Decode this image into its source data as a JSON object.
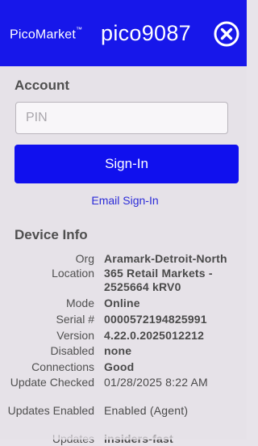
{
  "header": {
    "brand": "PicoMarket",
    "trademark": "™",
    "device_id": "pico9087",
    "close_icon": "close-circle-icon",
    "background_color": "#1717ea"
  },
  "account": {
    "title": "Account",
    "pin_placeholder": "PIN",
    "pin_value": "",
    "signin_label": "Sign-In",
    "email_signin_label": "Email Sign-In"
  },
  "device_info": {
    "title": "Device Info",
    "rows": [
      {
        "label": "Org",
        "value": "Aramark-Detroit-North"
      },
      {
        "label": "Location",
        "value": "365 Retail Markets - 2525664 kRV0"
      },
      {
        "label": "Mode",
        "value": "Online"
      },
      {
        "label": "Serial #",
        "value": "0000572194825991"
      },
      {
        "label": "Version",
        "value": "4.22.0.2025012212"
      },
      {
        "label": "Disabled",
        "value": "none"
      },
      {
        "label": "Connections",
        "value": "Good"
      },
      {
        "label": "Update Checked",
        "value": "01/28/2025 8:22 AM"
      },
      {
        "label": "Updates Enabled",
        "value": "Enabled (Agent)"
      },
      {
        "label": "Updates",
        "value": "insiders-fast"
      }
    ]
  }
}
